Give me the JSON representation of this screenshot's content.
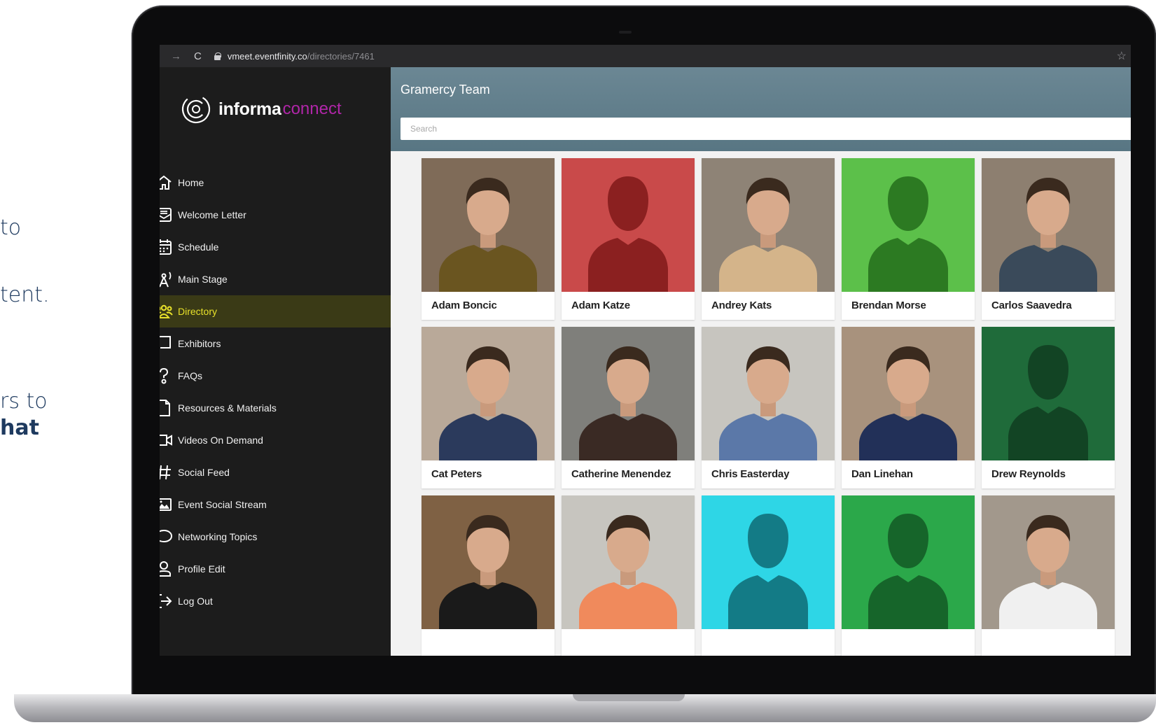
{
  "side_text": [
    {
      "text": "to",
      "bold": false
    },
    {
      "text": "tent.",
      "bold": false
    },
    {
      "text": "rs to",
      "bold": false
    },
    {
      "text": "hat",
      "bold": true
    }
  ],
  "browser": {
    "back": "←",
    "forward": "→",
    "reload": "C",
    "url_host": "vmeet.eventfinity.co",
    "url_path": "/directories/7461",
    "bookmark": "☆"
  },
  "brand": {
    "primary": "informa",
    "secondary": "connect",
    "accent_color": "#b026a8"
  },
  "sidebar": {
    "items": [
      {
        "label": "Home",
        "icon": "home-icon",
        "active": false
      },
      {
        "label": "Welcome Letter",
        "icon": "letter-icon",
        "active": false
      },
      {
        "label": "Schedule",
        "icon": "calendar-icon",
        "active": false
      },
      {
        "label": "Main Stage",
        "icon": "broadcast-icon",
        "active": false
      },
      {
        "label": "Directory",
        "icon": "people-icon",
        "active": true
      },
      {
        "label": "Exhibitors",
        "icon": "booth-icon",
        "active": false
      },
      {
        "label": "FAQs",
        "icon": "question-icon",
        "active": false
      },
      {
        "label": "Resources & Materials",
        "icon": "document-icon",
        "active": false
      },
      {
        "label": "Videos On Demand",
        "icon": "video-icon",
        "active": false
      },
      {
        "label": "Social Feed",
        "icon": "hashtag-icon",
        "active": false
      },
      {
        "label": "Event Social Stream",
        "icon": "image-icon",
        "active": false
      },
      {
        "label": "Networking Topics",
        "icon": "chat-bubble-icon",
        "active": false
      },
      {
        "label": "Profile Edit",
        "icon": "user-icon",
        "active": false
      },
      {
        "label": "Log Out",
        "icon": "logout-icon",
        "active": false
      }
    ]
  },
  "main": {
    "title": "Gramercy Team",
    "search_placeholder": "Search",
    "header_color": "#62808d",
    "active_color": "#e8e12a"
  },
  "directory": [
    {
      "name": "Adam Boncic",
      "photo": "photo",
      "bg": "#8a7560",
      "shirt": "#6a5520"
    },
    {
      "name": "Adam Katze",
      "photo": "placeholder",
      "bg": "#c94a4a",
      "sil": "#8b2020"
    },
    {
      "name": "Andrey Kats",
      "photo": "photo",
      "bg": "#9b8f80",
      "shirt": "#d4b48a"
    },
    {
      "name": "Brendan Morse",
      "photo": "placeholder",
      "bg": "#5cc04a",
      "sil": "#2c7a22"
    },
    {
      "name": "Carlos Saavedra",
      "photo": "photo",
      "bg": "#9a8a7a",
      "shirt": "#3a4a5a"
    },
    {
      "name": "Cat Peters",
      "photo": "photo",
      "bg": "#c9b8a6",
      "shirt": "#2b3a5c"
    },
    {
      "name": "Catherine Menendez",
      "photo": "photo",
      "bg": "#8a8a86",
      "shirt": "#3a2a24"
    },
    {
      "name": "Chris Easterday",
      "photo": "photo",
      "bg": "#d8d6d0",
      "shirt": "#5b78a8"
    },
    {
      "name": "Dan Linehan",
      "photo": "photo",
      "bg": "#b79f88",
      "shirt": "#223058"
    },
    {
      "name": "Drew Reynolds",
      "photo": "placeholder",
      "bg": "#1f6b3a",
      "sil": "#124424"
    },
    {
      "name": "",
      "photo": "photo",
      "bg": "#8a6a4a",
      "shirt": "#1a1a1a"
    },
    {
      "name": "",
      "photo": "photo",
      "bg": "#d8d6d0",
      "shirt": "#f08a5c"
    },
    {
      "name": "",
      "photo": "placeholder",
      "bg": "#2ed6e6",
      "sil": "#137b86"
    },
    {
      "name": "",
      "photo": "placeholder",
      "bg": "#2ba84a",
      "sil": "#16652a"
    },
    {
      "name": "",
      "photo": "photo",
      "bg": "#b0a598",
      "shirt": "#f0f0f0"
    }
  ]
}
